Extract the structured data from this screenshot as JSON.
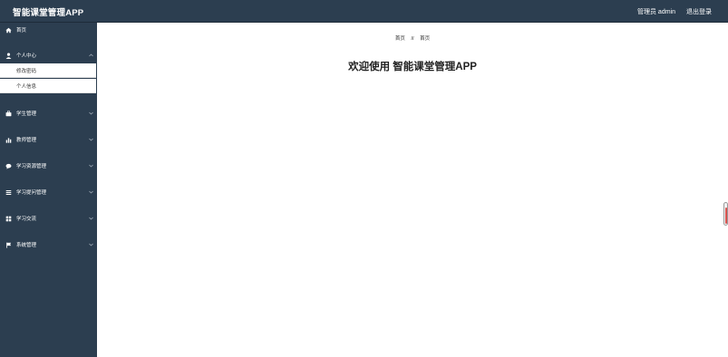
{
  "header": {
    "app_title": "智能课堂管理APP",
    "user_label": "管理员 admin",
    "logout_label": "退出登录"
  },
  "sidebar": {
    "items": [
      {
        "label": "首页",
        "icon": "home-icon"
      },
      {
        "label": "个人中心",
        "icon": "user-icon",
        "expanded": true,
        "children": [
          {
            "label": "修改密码"
          },
          {
            "label": "个人信息"
          }
        ]
      },
      {
        "label": "学生管理",
        "icon": "briefcase-icon"
      },
      {
        "label": "教师管理",
        "icon": "bar-chart-icon"
      },
      {
        "label": "学习资源管理",
        "icon": "chat-bubble-icon"
      },
      {
        "label": "学习提问管理",
        "icon": "list-icon"
      },
      {
        "label": "学习交流",
        "icon": "grid-icon"
      },
      {
        "label": "系统管理",
        "icon": "flag-icon"
      }
    ]
  },
  "main": {
    "breadcrumb": {
      "home": "首页",
      "separator": "//",
      "current": "首页"
    },
    "welcome_text": "欢迎使用 智能课堂管理APP"
  }
}
